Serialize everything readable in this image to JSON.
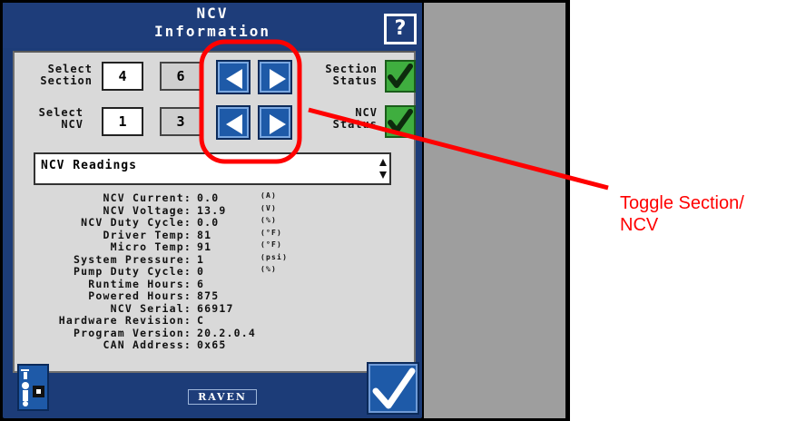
{
  "window": {
    "title_line1": "NCV",
    "title_line2": "Information",
    "help_label": "?"
  },
  "section": {
    "label_line1": "Select",
    "label_line2": "Section",
    "value": "4",
    "total": "6",
    "status_label_line1": "Section",
    "status_label_line2": "Status"
  },
  "ncv": {
    "label_line1": "Select",
    "label_line2": "NCV",
    "value": "1",
    "total": "3",
    "status_label_line1": "NCV",
    "status_label_line2": "Status"
  },
  "dropdown": {
    "value": "NCV Readings"
  },
  "readings": [
    {
      "label": "NCV Current:",
      "value": "0.0",
      "unit": "(A)"
    },
    {
      "label": "NCV Voltage:",
      "value": "13.9",
      "unit": "(V)"
    },
    {
      "label": "NCV Duty Cycle:",
      "value": "0.0",
      "unit": "(%)"
    },
    {
      "label": "Driver Temp:",
      "value": "81",
      "unit": "(°F)"
    },
    {
      "label": "Micro Temp:",
      "value": "91",
      "unit": "(°F)"
    },
    {
      "label": "System Pressure:",
      "value": "1",
      "unit": "(psi)"
    },
    {
      "label": "Pump Duty Cycle:",
      "value": "0",
      "unit": "(%)"
    },
    {
      "label": "Runtime Hours:",
      "value": "6",
      "unit": ""
    },
    {
      "label": "Powered Hours:",
      "value": "875",
      "unit": ""
    },
    {
      "label": "NCV Serial:",
      "value": "66917",
      "unit": ""
    },
    {
      "label": "Hardware Revision:",
      "value": "C",
      "unit": ""
    },
    {
      "label": "Program Version:",
      "value": "20.2.0.4",
      "unit": ""
    },
    {
      "label": "CAN Address:",
      "value": "0x65",
      "unit": ""
    }
  ],
  "brand": {
    "logo_text": "RAVEN"
  },
  "callout": {
    "line1": "Toggle Section/",
    "line2": "NCV"
  },
  "colors": {
    "accent": "#1e5aa8",
    "title_bar": "#1e3d7a",
    "status_ok": "#3fae3f",
    "callout": "#ff0000"
  }
}
